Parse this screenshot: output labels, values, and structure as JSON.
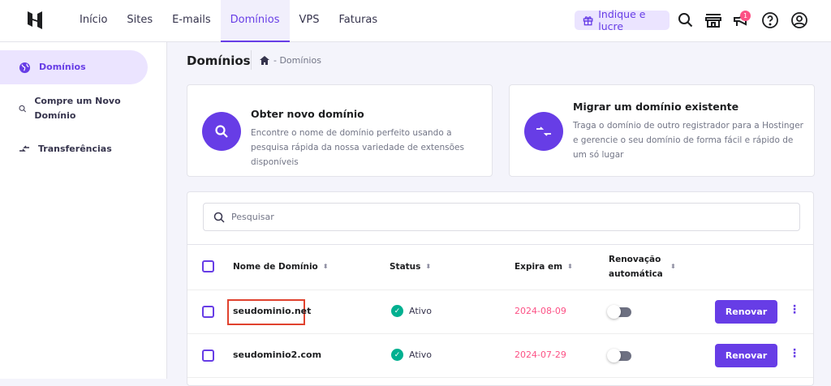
{
  "header": {
    "nav": [
      "Início",
      "Sites",
      "E-mails",
      "Domínios",
      "VPS",
      "Faturas"
    ],
    "active_nav": "Domínios",
    "refer_label": "Indique e lucre",
    "notification_count": "1"
  },
  "sidebar": {
    "items": [
      {
        "label": "Domínios"
      },
      {
        "label": "Compre um Novo Domínio"
      },
      {
        "label": "Transferências"
      }
    ]
  },
  "page": {
    "title": "Domínios",
    "breadcrumb": "- Domínios"
  },
  "cards": [
    {
      "title": "Obter novo domínio",
      "description": "Encontre o nome de domínio perfeito usando a pesquisa rápida da nossa variedade de extensões disponíveis"
    },
    {
      "title": "Migrar um domínio existente",
      "description": "Traga o domínio de outro registrador para a Hostinger e gerencie o seu domínio de forma fácil e rápido de um só lugar"
    }
  ],
  "table": {
    "search_placeholder": "Pesquisar",
    "columns": [
      "Nome de Domínio",
      "Status",
      "Expira em",
      "Renovação automática"
    ],
    "rows": [
      {
        "domain": "seudominio.net",
        "status": "Ativo",
        "expires": "2024-08-09",
        "auto_renew": false,
        "action": "Renovar"
      },
      {
        "domain": "seudominio2.com",
        "status": "Ativo",
        "expires": "2024-07-29",
        "auto_renew": false,
        "action": "Renovar"
      }
    ]
  },
  "colors": {
    "accent": "#673de6",
    "date": "#fc5185",
    "success": "#00b090",
    "highlight": "#e0422e"
  }
}
